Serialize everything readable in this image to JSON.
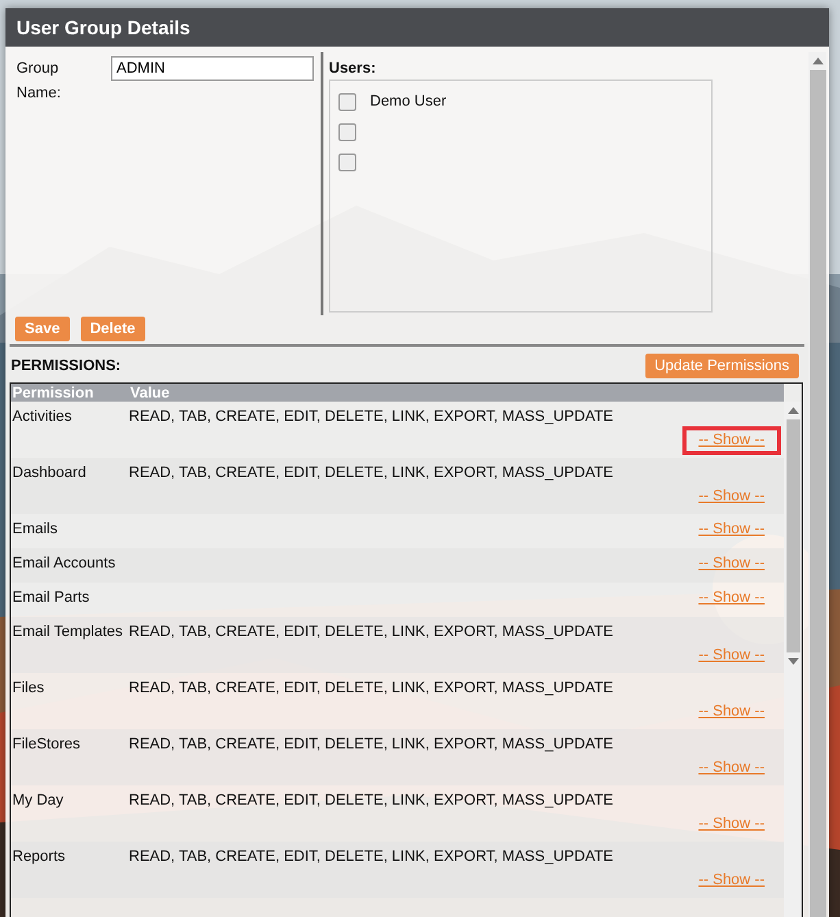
{
  "window": {
    "title": "User Group Details"
  },
  "group_name": {
    "label": "Group Name:",
    "value": "ADMIN"
  },
  "users": {
    "label": "Users:",
    "items": [
      {
        "name": "Demo User",
        "checked": false
      },
      {
        "checked": false
      },
      {
        "checked": false
      }
    ]
  },
  "buttons": [
    "Save",
    "Delete"
  ],
  "permissions": {
    "label": "PERMISSIONS:",
    "update_button": "Update Permissions",
    "columns": [
      "Permission",
      "Value"
    ],
    "rows": [
      {
        "permission": "Activities",
        "value": "READ, TAB, CREATE, EDIT, DELETE, LINK, EXPORT, MASS_UPDATE",
        "link": "-- Show --",
        "highlighted": true
      },
      {
        "permission": "Dashboard",
        "value": "READ, TAB, CREATE, EDIT, DELETE, LINK, EXPORT, MASS_UPDATE",
        "link": "-- Show --",
        "highlighted": false
      },
      {
        "permission": "Emails",
        "link": "-- Show --",
        "highlighted": false
      },
      {
        "permission": "Email Accounts",
        "link": "-- Show --",
        "highlighted": false
      },
      {
        "permission": "Email Parts",
        "link": "-- Show --",
        "highlighted": false
      },
      {
        "permission": "Email Templates",
        "value": "READ, TAB, CREATE, EDIT, DELETE, LINK, EXPORT, MASS_UPDATE",
        "link": "-- Show --",
        "highlighted": false
      },
      {
        "permission": "Files",
        "value": "READ, TAB, CREATE, EDIT, DELETE, LINK, EXPORT, MASS_UPDATE",
        "link": "-- Show --",
        "highlighted": false
      },
      {
        "permission": "FileStores",
        "value": "READ, TAB, CREATE, EDIT, DELETE, LINK, EXPORT, MASS_UPDATE",
        "link": "-- Show --",
        "highlighted": false
      },
      {
        "permission": "My Day",
        "value": "READ, TAB, CREATE, EDIT, DELETE, LINK, EXPORT, MASS_UPDATE",
        "link": "-- Show --",
        "highlighted": false
      },
      {
        "permission": "Reports",
        "value": "READ, TAB, CREATE, EDIT, DELETE, LINK, EXPORT, MASS_UPDATE",
        "link": "-- Show --",
        "highlighted": false
      }
    ]
  }
}
